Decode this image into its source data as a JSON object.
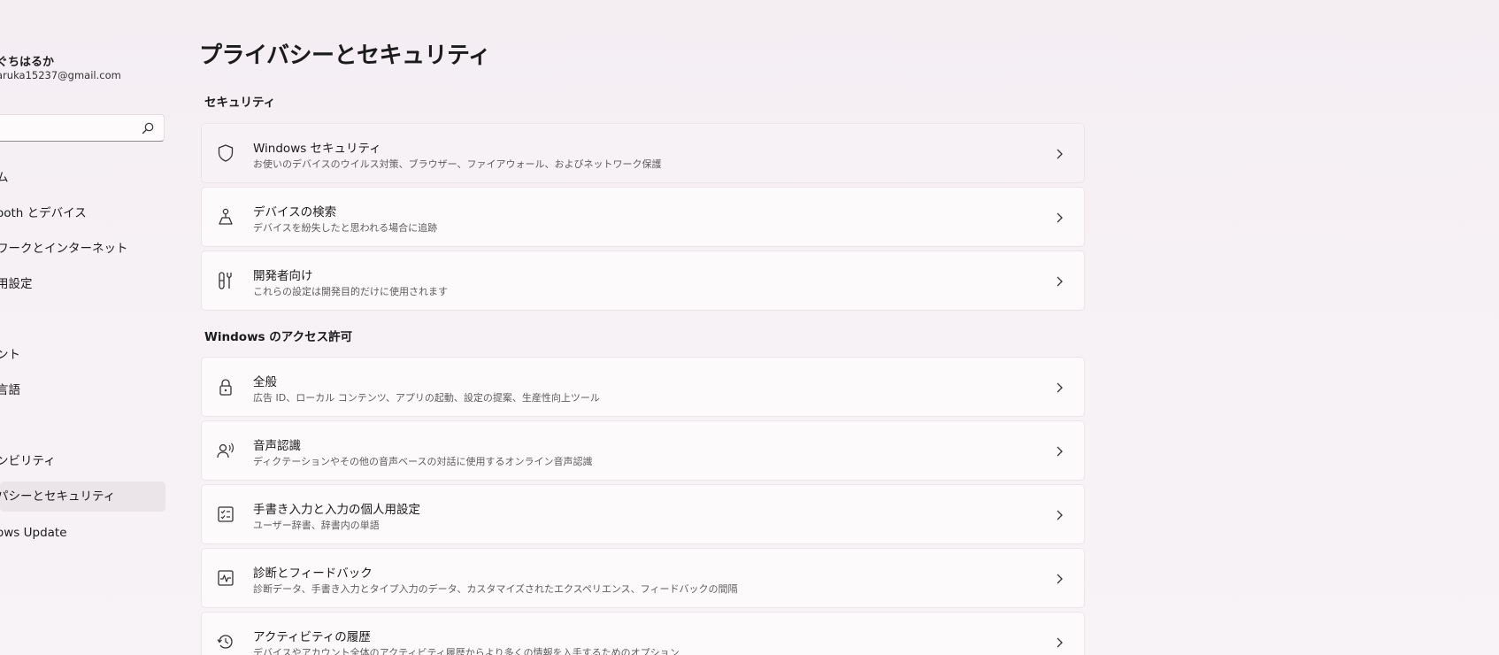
{
  "sidebar": {
    "user_name": "ぐちはるか",
    "user_email": "aruka15237@gmail.com",
    "search_placeholder": "",
    "items": [
      {
        "label": "ム"
      },
      {
        "label": "ooth とデバイス"
      },
      {
        "label": "ワークとインターネット"
      },
      {
        "label": "用設定"
      },
      {
        "label": "ント"
      },
      {
        "label": "言語"
      },
      {
        "label": "ンビリティ"
      },
      {
        "label": "パシーとセキュリティ"
      },
      {
        "label": "ows Update"
      }
    ]
  },
  "main": {
    "title": "プライバシーとセキュリティ",
    "sections": [
      {
        "title": "セキュリティ",
        "cards": [
          {
            "icon": "shield-icon",
            "title": "Windows セキュリティ",
            "desc": "お使いのデバイスのウイルス対策、ブラウザー、ファイアウォール、およびネットワーク保護"
          },
          {
            "icon": "find-device-icon",
            "title": "デバイスの検索",
            "desc": "デバイスを紛失したと思われる場合に追跡"
          },
          {
            "icon": "developer-tools-icon",
            "title": "開発者向け",
            "desc": "これらの設定は開発目的だけに使用されます"
          }
        ]
      },
      {
        "title": "Windows のアクセス許可",
        "cards": [
          {
            "icon": "lock-icon",
            "title": "全般",
            "desc": "広告 ID、ローカル コンテンツ、アプリの起動、設定の提案、生産性向上ツール"
          },
          {
            "icon": "speech-icon",
            "title": "音声認識",
            "desc": "ディクテーションやその他の音声ベースの対話に使用するオンライン音声認識"
          },
          {
            "icon": "handwriting-icon",
            "title": "手書き入力と入力の個人用設定",
            "desc": "ユーザー辞書、辞書内の単語"
          },
          {
            "icon": "diagnostics-icon",
            "title": "診断とフィードバック",
            "desc": "診断データ、手書き入力とタイプ入力のデータ、カスタマイズされたエクスペリエンス、フィードバックの間隔"
          },
          {
            "icon": "history-icon",
            "title": "アクティビティの履歴",
            "desc": "デバイスやアカウント全体のアクティビティ履歴からより多くの情報を入手するためのオプション"
          }
        ]
      }
    ]
  }
}
